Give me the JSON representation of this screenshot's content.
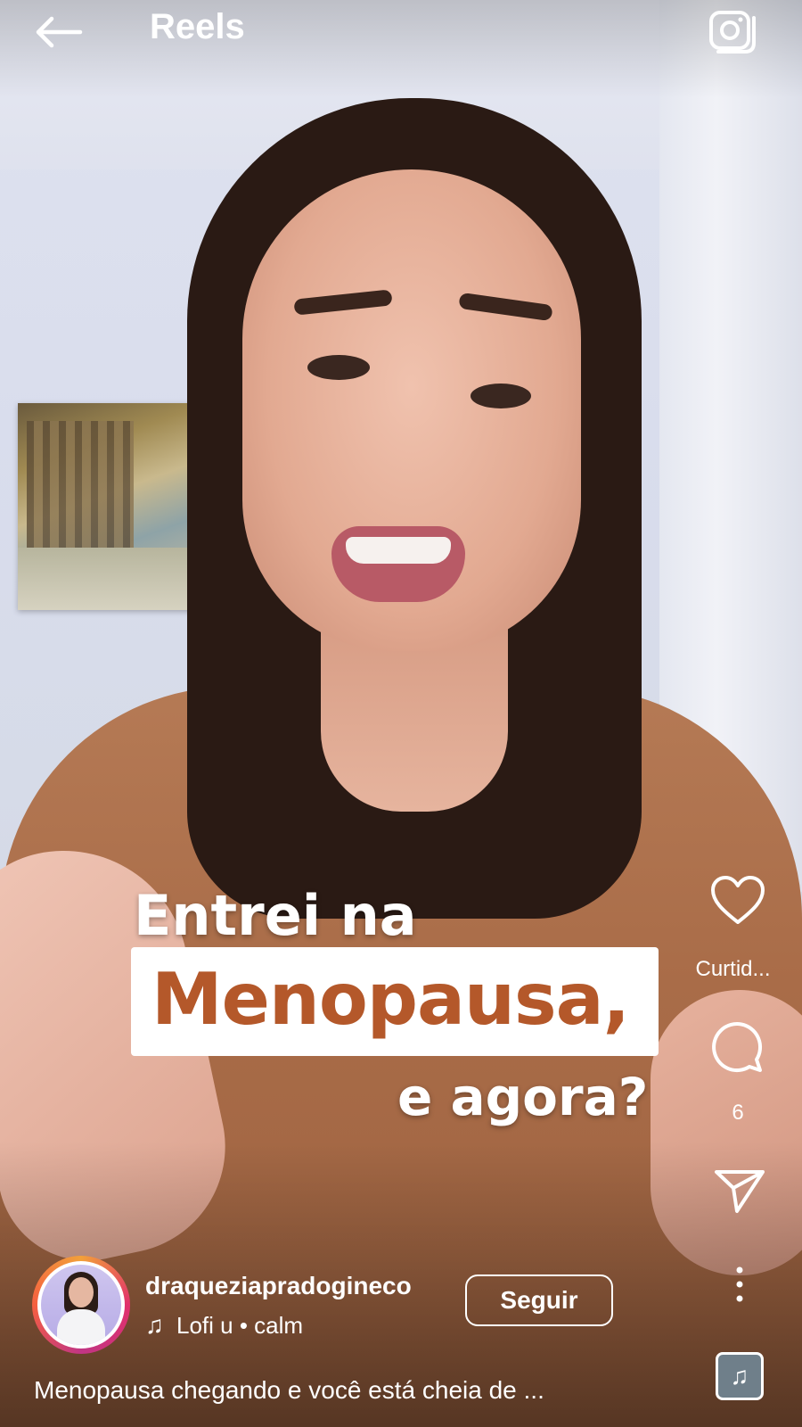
{
  "header": {
    "title": "Reels",
    "back_icon": "arrow-left-icon",
    "camera_icon": "camera-icon"
  },
  "video_overlay": {
    "line1": "Entrei na",
    "line2": "Menopausa,",
    "line3": "e agora?",
    "highlight_color": "#b4582a"
  },
  "actions": {
    "like_label": "Curtid...",
    "comment_count": "6",
    "icons": [
      "heart-icon",
      "comment-icon",
      "send-icon",
      "more-vertical-icon"
    ]
  },
  "author": {
    "username": "draqueziapradogineco",
    "follow_label": "Seguir",
    "music": "Lofi u • calm"
  },
  "caption": "Menopausa chegando e você está cheia de ...",
  "colors": {
    "overlay_text": "#ffffff",
    "story_ring": [
      "#f2a03a",
      "#e1306c",
      "#c13584"
    ]
  }
}
